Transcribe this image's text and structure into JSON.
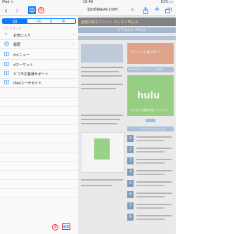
{
  "status_bar": {
    "carrier": "iPad ≈",
    "time": "16:40",
    "battery": "61% ▭"
  },
  "browser": {
    "url": "ipodwave.com",
    "back_icon": "chevron-left-icon",
    "forward_icon": "chevron-right-icon",
    "bookmarks_icon": "book-icon"
  },
  "annotations": {
    "callout1": "①",
    "callout2": "②"
  },
  "sidebar": {
    "tabs": [
      "bookmarks",
      "reading-list",
      "shared-links"
    ],
    "section_header": "ブックマーク",
    "items": [
      {
        "label": "お気に入り",
        "icon": "star-icon",
        "chevron": "›"
      },
      {
        "label": "履歴",
        "icon": "clock-icon",
        "chevron": "›"
      },
      {
        "label": "dメニュー",
        "icon": "book-icon"
      },
      {
        "label": "dマーケット",
        "icon": "book-icon"
      },
      {
        "label": "ドコモお客様サポート",
        "icon": "book-icon"
      },
      {
        "label": "iPadユーザガイド",
        "icon": "book-icon"
      }
    ],
    "edit_label": "編集"
  },
  "page": {
    "top_banner": "話題の新タブレット カンタン申込み",
    "nav_text": "スマホカタン申込み",
    "hulu_logo": "hulu",
    "hulu_text": "いまなら2週間 無料トライアル",
    "side_text_1": "タブレットに乗り換えて",
    "side_text_2": "iPad向けホームページ作成",
    "ranking_header": "アクセスランキング",
    "ranking_numbers": [
      "1",
      "2",
      "3",
      "4",
      "5",
      "6",
      "7",
      "8"
    ]
  },
  "colors": {
    "accent": "#0a7bff",
    "callout": "#e2261d",
    "hulu": "#5bbf3a"
  }
}
